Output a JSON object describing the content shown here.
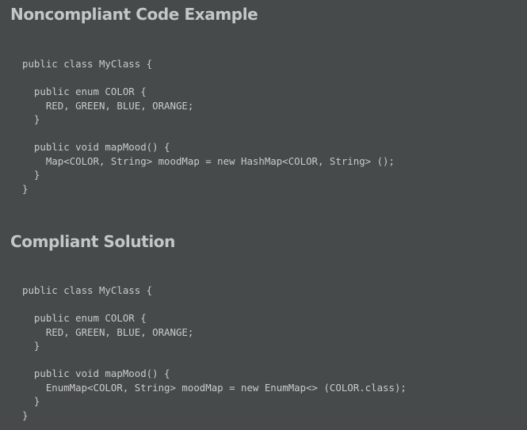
{
  "sections": [
    {
      "heading": "Noncompliant Code Example",
      "code_lines": [
        "public class MyClass {",
        "",
        "  public enum COLOR {",
        "    RED, GREEN, BLUE, ORANGE;",
        "  }",
        "",
        "  public void mapMood() {",
        "    Map<COLOR, String> moodMap = new HashMap<COLOR, String> ();",
        "  }",
        "}"
      ]
    },
    {
      "heading": "Compliant Solution",
      "code_lines": [
        "public class MyClass {",
        "",
        "  public enum COLOR {",
        "    RED, GREEN, BLUE, ORANGE;",
        "  }",
        "",
        "  public void mapMood() {",
        "    EnumMap<COLOR, String> moodMap = new EnumMap<> (COLOR.class);",
        "  }",
        "}"
      ]
    }
  ],
  "colors": {
    "background": "#464a4b",
    "heading": "#c4c7c8",
    "code_text": "#c9cbcc"
  }
}
